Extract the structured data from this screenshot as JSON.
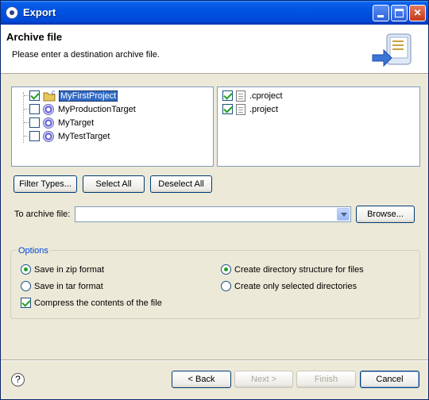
{
  "window": {
    "title": "Export",
    "icon": "eclipse-icon"
  },
  "banner": {
    "heading": "Archive file",
    "description": "Please enter a destination archive file."
  },
  "resources": {
    "projects": [
      {
        "label": "MyFirstProject",
        "checked": true,
        "selected": true,
        "icon": "project-folder-icon"
      },
      {
        "label": "MyProductionTarget",
        "checked": false,
        "icon": "target-icon"
      },
      {
        "label": "MyTarget",
        "checked": false,
        "icon": "target-icon"
      },
      {
        "label": "MyTestTarget",
        "checked": false,
        "icon": "target-icon"
      }
    ],
    "files": [
      {
        "label": ".cproject",
        "checked": true,
        "icon": "file-icon"
      },
      {
        "label": ".project",
        "checked": true,
        "icon": "file-icon"
      }
    ]
  },
  "selection_buttons": {
    "filter_types": "Filter Types...",
    "select_all": "Select All",
    "deselect_all": "Deselect All"
  },
  "destination": {
    "label": "To archive file:",
    "value": "",
    "browse": "Browse..."
  },
  "options": {
    "legend": "Options",
    "zip": {
      "label": "Save in zip format",
      "checked": true
    },
    "tar": {
      "label": "Save in tar format",
      "checked": false
    },
    "compress": {
      "label": "Compress the contents of the file",
      "checked": true
    },
    "dir_structure": {
      "label": "Create directory structure for files",
      "checked": true
    },
    "selected_dirs": {
      "label": "Create only selected directories",
      "checked": false
    }
  },
  "footer": {
    "back": "< Back",
    "next": "Next >",
    "finish": "Finish",
    "cancel": "Cancel"
  }
}
